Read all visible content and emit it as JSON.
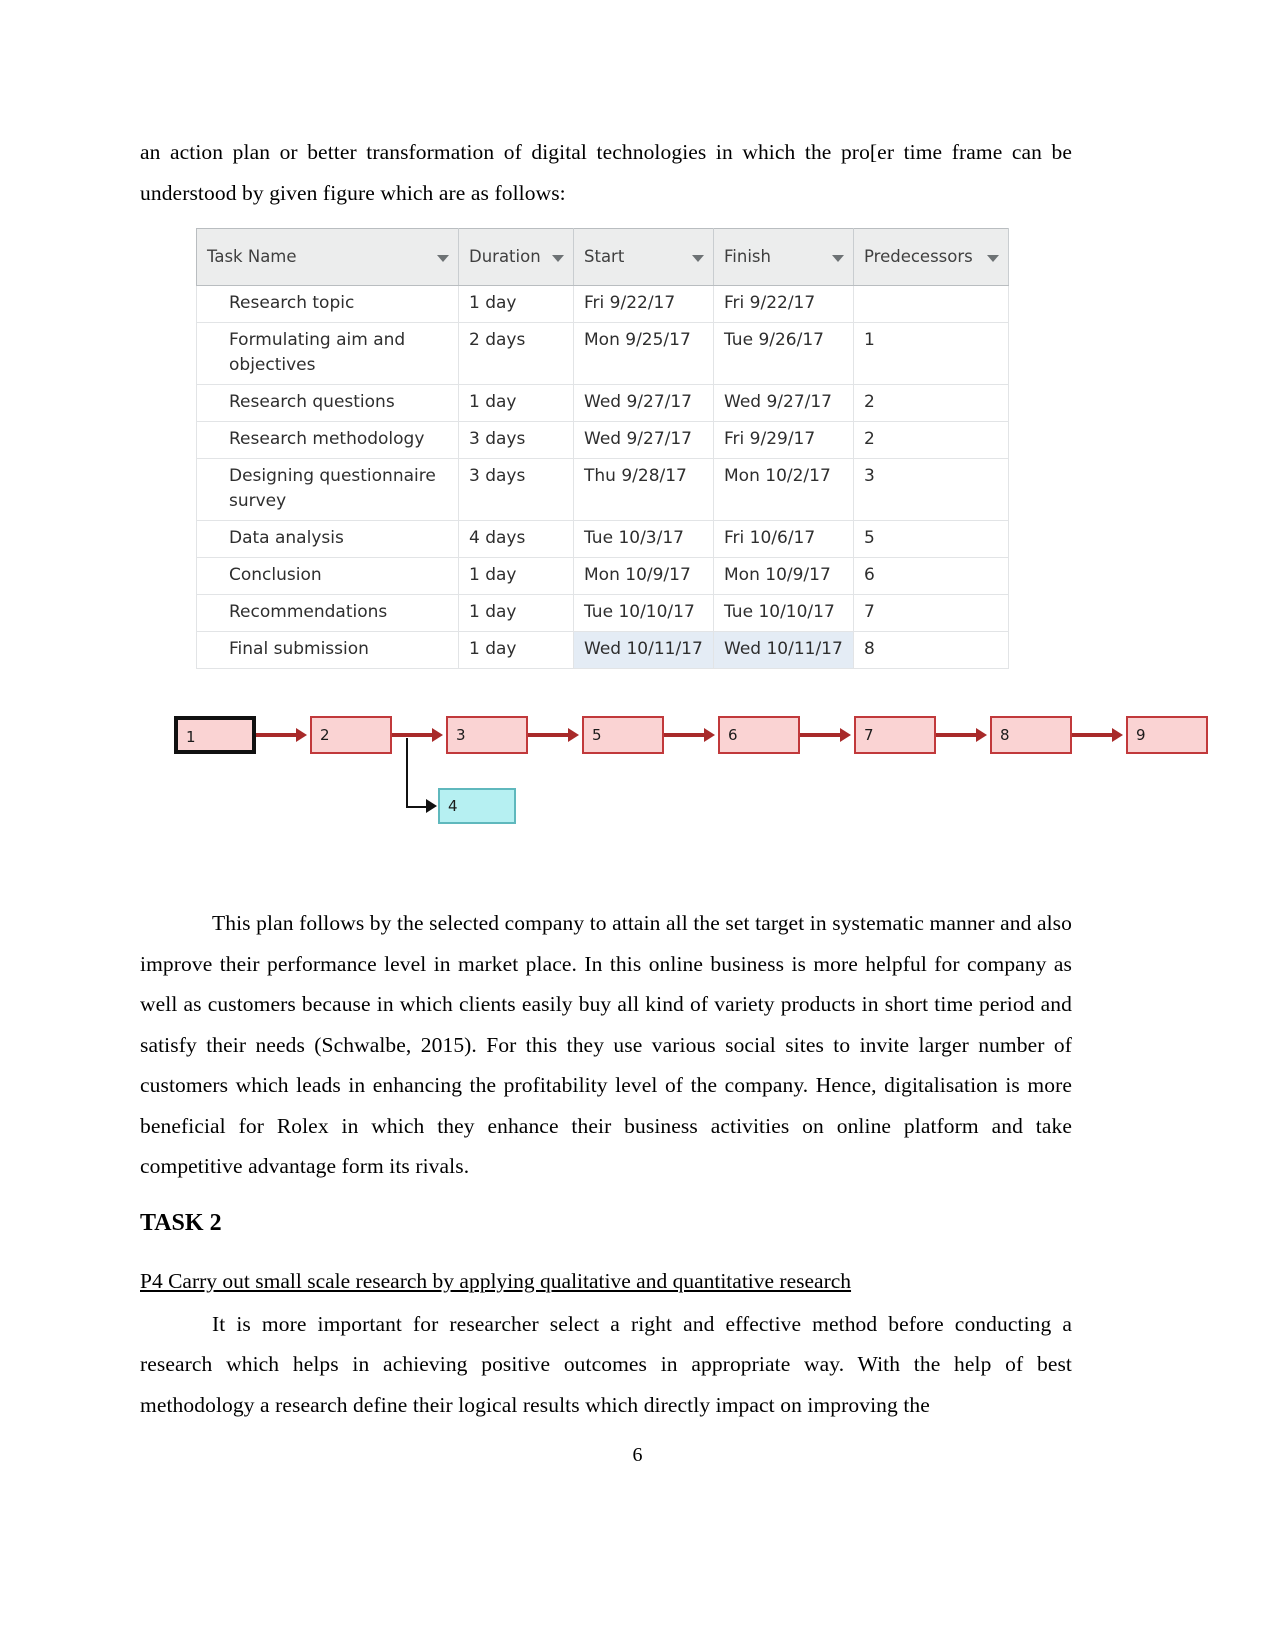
{
  "document": {
    "page_number": "6",
    "intro_paragraph": "an action plan or better transformation of digital technologies in which the pro[er time frame can be understood by given figure which are as follows:",
    "after_diagram_paragraph": "This plan follows by the selected company to attain all the set target in systematic manner and also improve their performance level in market place. In this online business is more helpful for company as well as customers because in which clients easily buy all kind of variety products in short time period and satisfy their needs (Schwalbe, 2015). For this they use various social sites to invite larger number of customers which leads in enhancing the profitability level of the company. Hence, digitalisation is more beneficial for Rolex in which they enhance their business activities on online platform and take competitive advantage form its rivals.",
    "task_heading": "TASK 2",
    "sub_heading": "P4 Carry out small scale research by applying qualitative and quantitative research",
    "final_paragraph": "It is more important for researcher select a right and effective method before conducting a research which helps in achieving positive outcomes in appropriate way. With the help of best methodology a research define their logical results which directly impact on improving the"
  },
  "project_table": {
    "headers": [
      {
        "label": "Task Name",
        "filter": "filter-dropdown-arrow"
      },
      {
        "label": "Duration",
        "filter": "filter-dropdown-arrow"
      },
      {
        "label": "Start",
        "filter": "filter-dropdown-arrow"
      },
      {
        "label": "Finish",
        "filter": "filter-dropdown-arrow"
      },
      {
        "label": "Predecessors",
        "filter": "filter-dropdown-arrow"
      }
    ],
    "rows": [
      {
        "task": "Research topic",
        "duration": "1 day",
        "start": "Fri 9/22/17",
        "finish": "Fri 9/22/17",
        "predecessors": ""
      },
      {
        "task": "Formulating aim and objectives",
        "duration": "2 days",
        "start": "Mon 9/25/17",
        "finish": "Tue 9/26/17",
        "predecessors": "1"
      },
      {
        "task": "Research questions",
        "duration": "1 day",
        "start": "Wed 9/27/17",
        "finish": "Wed 9/27/17",
        "predecessors": "2"
      },
      {
        "task": "Research methodology",
        "duration": "3 days",
        "start": "Wed 9/27/17",
        "finish": "Fri 9/29/17",
        "predecessors": "2"
      },
      {
        "task": "Designing questionnaire survey",
        "duration": "3 days",
        "start": "Thu 9/28/17",
        "finish": "Mon 10/2/17",
        "predecessors": "3"
      },
      {
        "task": "Data analysis",
        "duration": "4 days",
        "start": "Tue 10/3/17",
        "finish": "Fri 10/6/17",
        "predecessors": "5"
      },
      {
        "task": "Conclusion",
        "duration": "1 day",
        "start": "Mon 10/9/17",
        "finish": "Mon 10/9/17",
        "predecessors": "6"
      },
      {
        "task": "Recommendations",
        "duration": "1 day",
        "start": "Tue 10/10/17",
        "finish": "Tue 10/10/17",
        "predecessors": "7"
      },
      {
        "task": "Final submission",
        "duration": "1 day",
        "start": "Wed 10/11/17",
        "finish": "Wed 10/11/17",
        "predecessors": "8",
        "selected": true
      }
    ]
  },
  "network_diagram": {
    "colors": {
      "node_fill": "#fad3d3",
      "node_border": "#c1393b",
      "first_node_border": "#111111",
      "branch_node_fill": "#b6f0f2",
      "branch_node_border": "#5fb8bd",
      "connector": "#a82a2a"
    },
    "nodes": [
      {
        "label": "1",
        "style": "first"
      },
      {
        "label": "2",
        "style": "normal"
      },
      {
        "label": "3",
        "style": "normal"
      },
      {
        "label": "5",
        "style": "normal"
      },
      {
        "label": "6",
        "style": "normal"
      },
      {
        "label": "7",
        "style": "normal"
      },
      {
        "label": "8",
        "style": "normal"
      },
      {
        "label": "9",
        "style": "normal"
      },
      {
        "label": "4",
        "style": "branch"
      }
    ]
  }
}
